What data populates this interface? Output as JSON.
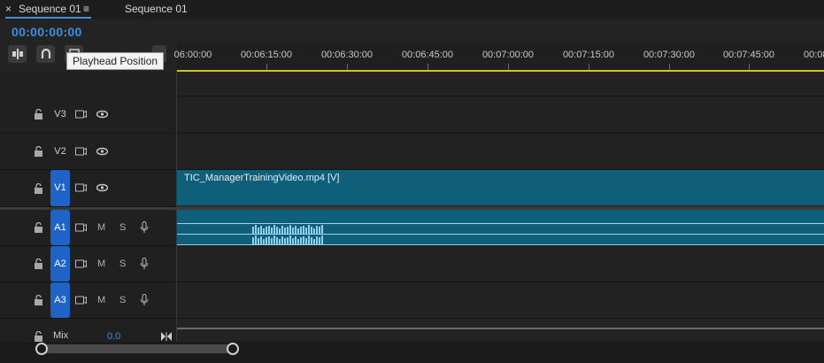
{
  "tabs": [
    {
      "label": "Sequence 01",
      "close": "×",
      "menu": "≡",
      "active": true
    },
    {
      "label": "Sequence 01",
      "active": false
    }
  ],
  "timecode": "00:00:00:00",
  "tooltip": "Playhead Position",
  "ruler": {
    "first_label": "06:00:00",
    "labels": [
      "00:06:15:00",
      "00:06:30:00",
      "00:06:45:00",
      "00:07:00:00",
      "00:07:15:00",
      "00:07:30:00",
      "00:07:45:00",
      "00:08"
    ]
  },
  "tracks": {
    "video": [
      {
        "name": "V3",
        "active": false
      },
      {
        "name": "V2",
        "active": false
      },
      {
        "name": "V1",
        "active": true
      }
    ],
    "audio": [
      {
        "name": "A1",
        "active": true,
        "m": "M",
        "s": "S"
      },
      {
        "name": "A2",
        "active": true,
        "m": "M",
        "s": "S"
      },
      {
        "name": "A3",
        "active": true,
        "m": "M",
        "s": "S"
      }
    ]
  },
  "clips": {
    "v1": "TIC_ManagerTrainingVideo.mp4 [V]"
  },
  "mix": {
    "label": "Mix",
    "value": "0.0"
  },
  "colors": {
    "accent": "#3f8fe0",
    "track_active": "#1f63c6",
    "clip": "#0f5e7a",
    "playhead_bar": "#d8c01e"
  },
  "icons": [
    "lock-icon",
    "film-icon",
    "eye-icon",
    "mic-icon",
    "magnet-icon",
    "ripple-icon",
    "marker-icon"
  ]
}
